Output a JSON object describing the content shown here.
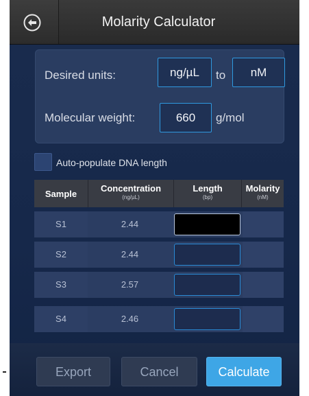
{
  "title": "Molarity Calculator",
  "settings": {
    "desired_units_label": "Desired units:",
    "from_unit": "ng/µL",
    "to_label": "to",
    "to_unit": "nM",
    "mw_label": "Molecular weight:",
    "mw_value": "660",
    "mw_unit": "g/mol"
  },
  "auto_populate": {
    "label": "Auto-populate DNA length",
    "checked": false
  },
  "table": {
    "columns": [
      {
        "name": "Sample",
        "unit": ""
      },
      {
        "name": "Concentration",
        "unit": "(ng/µL)"
      },
      {
        "name": "Length",
        "unit": "(bp)"
      },
      {
        "name": "Molarity",
        "unit": "(nM)"
      }
    ],
    "rows": [
      {
        "sample": "S1",
        "concentration": "2.44",
        "length": "",
        "molarity": ""
      },
      {
        "sample": "S2",
        "concentration": "2.44",
        "length": "",
        "molarity": ""
      },
      {
        "sample": "S3",
        "concentration": "2.57",
        "length": "",
        "molarity": ""
      },
      {
        "sample": "S4",
        "concentration": "2.46",
        "length": "",
        "molarity": ""
      }
    ]
  },
  "footer": {
    "export": "Export",
    "cancel": "Cancel",
    "calculate": "Calculate"
  },
  "colors": {
    "accent": "#3ea6e6",
    "field_border": "#2f9ae0",
    "background": "#1a2c4e"
  },
  "icons": {
    "back": "arrow-left-circle-icon"
  }
}
